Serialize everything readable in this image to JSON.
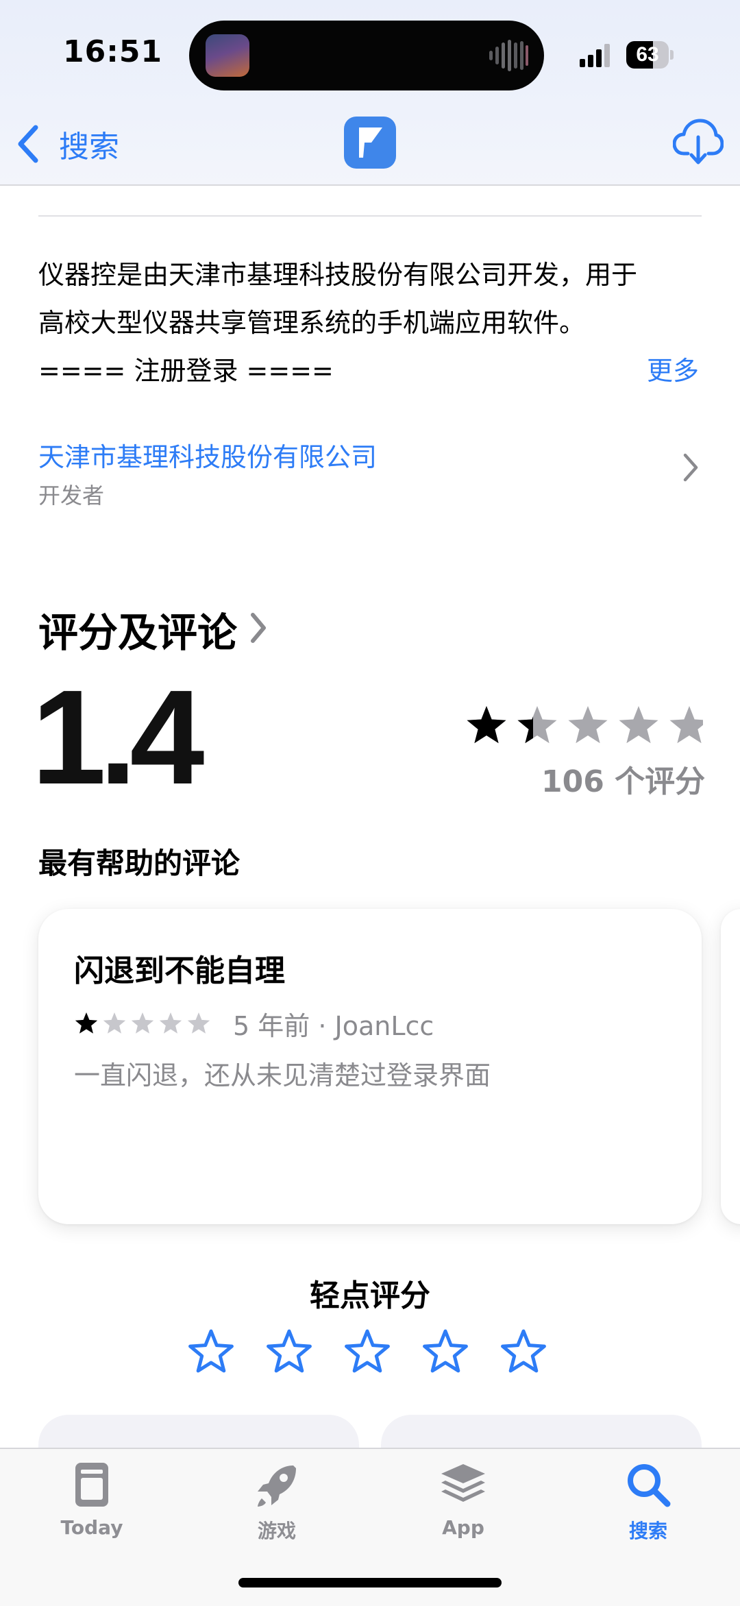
{
  "status_bar": {
    "time": "16:51",
    "battery": "63",
    "battery_level_percent": 63
  },
  "nav": {
    "back_label": "搜索"
  },
  "description": {
    "line1": "仪器控是由天津市基理科技股份有限公司开发，用于",
    "line2": "高校大型仪器共享管理系统的手机端应用软件。",
    "line3": "==== 注册登录 ====",
    "more_label": "更多"
  },
  "developer": {
    "name": "天津市基理科技股份有限公司",
    "role": "开发者"
  },
  "ratings": {
    "section_title": "评分及评论",
    "average": "1.4",
    "average_value": 1.4,
    "max_stars": 5,
    "count_label": "106 个评分",
    "helpful_title": "最有帮助的评论",
    "review": {
      "title": "闪退到不能自理",
      "stars": 1,
      "meta": "5 年前 · JoanLcc",
      "body": "一直闪退，还从未见清楚过登录界面"
    },
    "tap_to_rate_label": "轻点评分"
  },
  "tab_bar": {
    "items": [
      {
        "label": "Today",
        "icon": "today-icon",
        "active": false
      },
      {
        "label": "游戏",
        "icon": "rocket-icon",
        "active": false
      },
      {
        "label": "App",
        "icon": "app-stack-icon",
        "active": false
      },
      {
        "label": "搜索",
        "icon": "search-icon",
        "active": true
      }
    ]
  },
  "colors": {
    "accent": "#2d7cf6",
    "secondary_text": "#8a8a8e",
    "app_icon": "#3f86ea"
  }
}
